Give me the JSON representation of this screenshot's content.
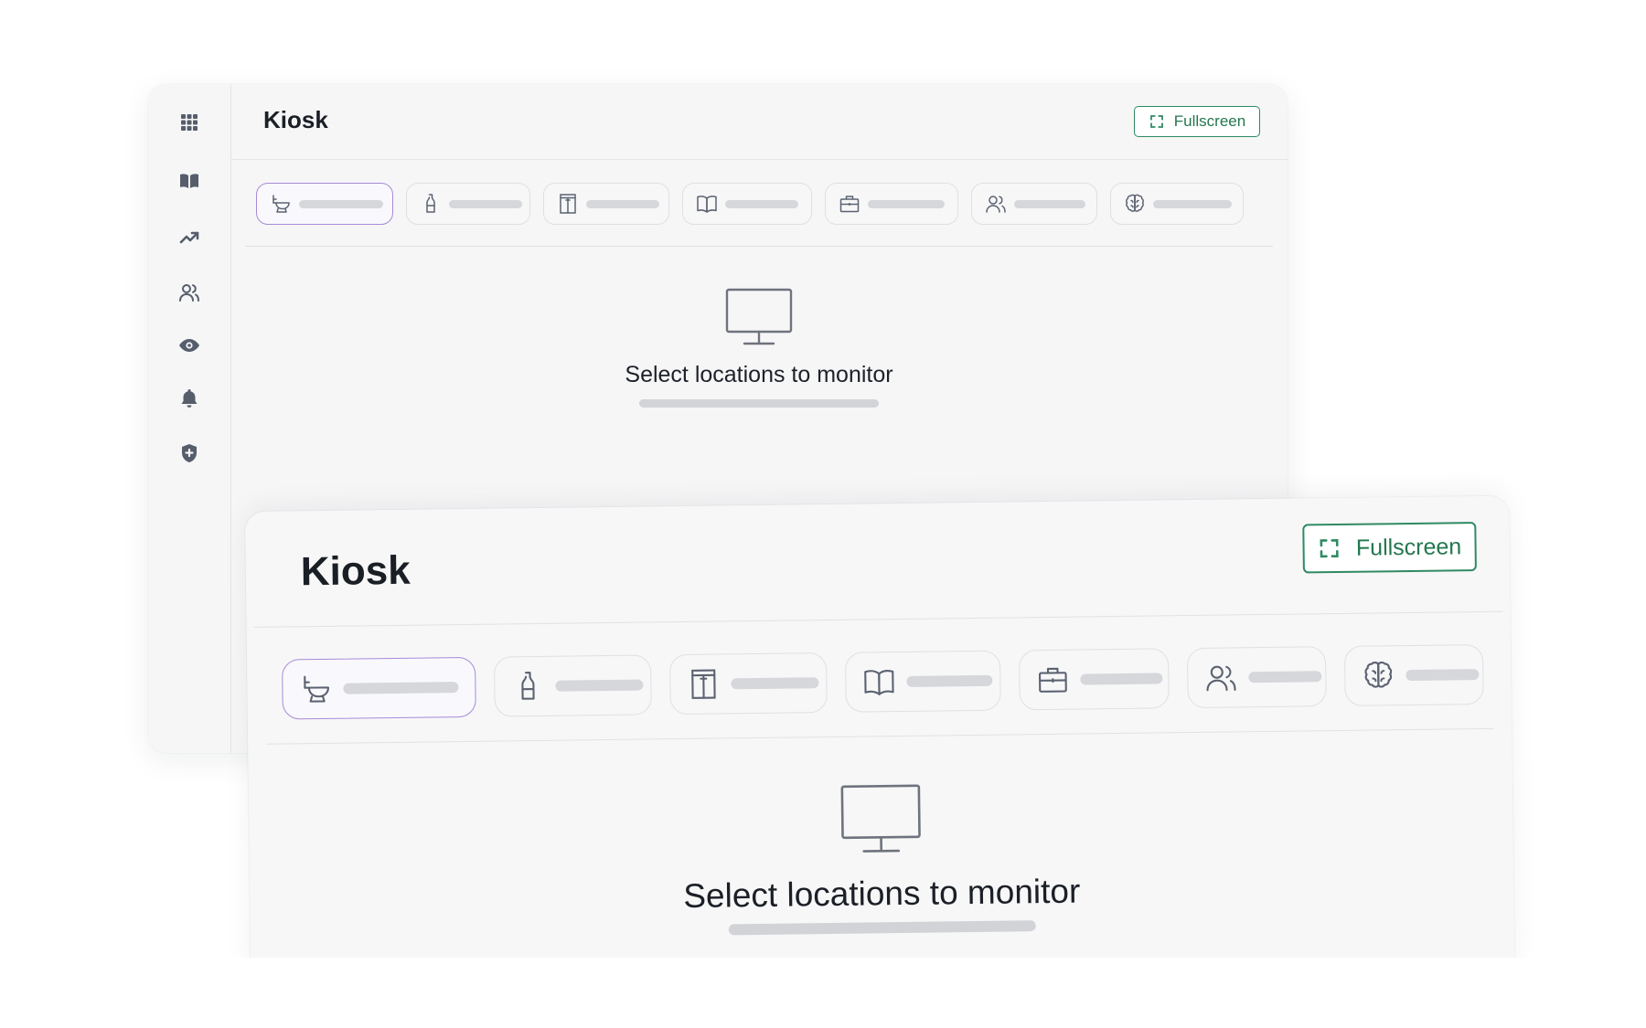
{
  "back": {
    "title": "Kiosk",
    "fullscreen_label": "Fullscreen",
    "empty_state": "Select locations to monitor",
    "sidebar": [
      {
        "icon": "grid-icon"
      },
      {
        "icon": "book-open-icon"
      },
      {
        "icon": "trending-up-icon"
      },
      {
        "icon": "users-icon"
      },
      {
        "icon": "eye-icon"
      },
      {
        "icon": "bell-icon"
      },
      {
        "icon": "shield-plus-icon"
      }
    ]
  },
  "front": {
    "title": "Kiosk",
    "fullscreen_label": "Fullscreen",
    "empty_state": "Select locations to monitor"
  },
  "location_tabs": [
    {
      "icon": "toilet-icon",
      "active": true
    },
    {
      "icon": "bottle-icon",
      "active": false
    },
    {
      "icon": "door-icon",
      "active": false
    },
    {
      "icon": "book-icon",
      "active": false
    },
    {
      "icon": "briefcase-icon",
      "active": false
    },
    {
      "icon": "users-icon",
      "active": false
    },
    {
      "icon": "brain-icon",
      "active": false
    }
  ],
  "colors": {
    "accent_green": "#2f8a63",
    "active_tab_border": "#a78bd6",
    "icon_gray": "#5b6270",
    "placeholder_bar": "#d6d7da"
  }
}
